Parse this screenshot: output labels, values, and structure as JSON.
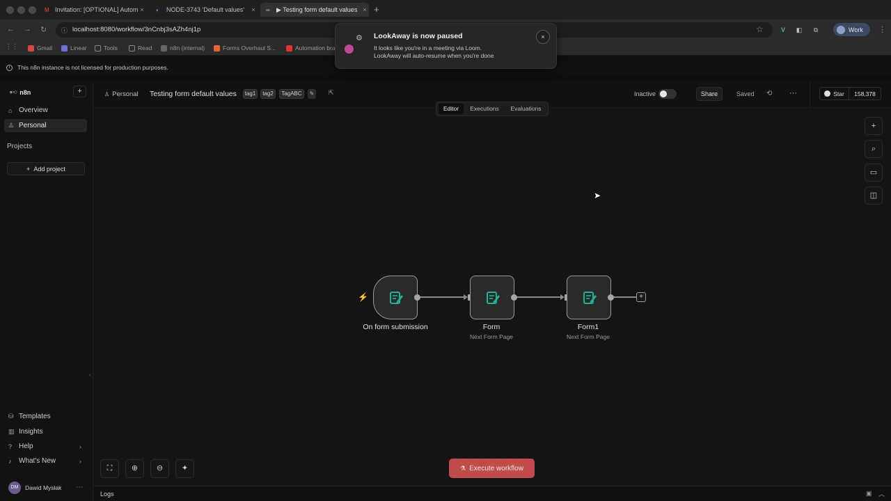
{
  "browser": {
    "tabs": [
      {
        "label": "Invitation: [OPTIONAL] Automa",
        "icon": "gmail-icon"
      },
      {
        "label": "NODE-3743 'Default values'",
        "icon": "linear-icon"
      },
      {
        "label": "▶ Testing form default values",
        "icon": "n8n-icon"
      }
    ],
    "new_tab": "+",
    "url": "localhost:8080/workflow/3nCnbj3sAZh4nj1p",
    "profile": "Work",
    "bookmarks": [
      "Gmail",
      "Linear",
      "Tools",
      "Read",
      "n8n (internal)",
      "Forms Overhaul S...",
      "Automation bra"
    ]
  },
  "toast": {
    "title": "LookAway is now paused",
    "line1": "It looks like you're in a meeting via Loom.",
    "line2": "LookAway will auto-resume when you're done",
    "close": "×"
  },
  "banner": {
    "text": "This n8n instance is not licensed for production purposes."
  },
  "sidebar": {
    "logo": "n8n",
    "plus": "+",
    "items": [
      {
        "label": "Overview",
        "icon": "home-icon"
      },
      {
        "label": "Personal",
        "icon": "user-icon"
      }
    ],
    "projects_title": "Projects",
    "add_project": "Add project",
    "bottom": [
      {
        "label": "Templates",
        "icon": "templates-icon"
      },
      {
        "label": "Insights",
        "icon": "insights-icon"
      },
      {
        "label": "Help",
        "icon": "help-icon"
      },
      {
        "label": "What's New",
        "icon": "bell-icon"
      }
    ],
    "user": {
      "name": "Dawid Myslak",
      "initials": "DM"
    }
  },
  "header": {
    "breadcrumb": "Personal",
    "workflow_name": "Testing form default values",
    "tags": [
      "tag1",
      "tag2",
      "TagABC"
    ],
    "status": "Inactive",
    "active": false,
    "share": "Share",
    "saved": "Saved",
    "github_star": "Star",
    "github_count": "158,378"
  },
  "view_tabs": {
    "items": [
      "Editor",
      "Executions",
      "Evaluations"
    ],
    "selected": "Editor"
  },
  "workflow": {
    "nodes": [
      {
        "title": "On form submission",
        "subtitle": ""
      },
      {
        "title": "Form",
        "subtitle": "Next Form Page"
      },
      {
        "title": "Form1",
        "subtitle": "Next Form Page"
      }
    ]
  },
  "canvas": {
    "execute_label": "Execute workflow"
  },
  "logs": {
    "label": "Logs"
  },
  "colors": {
    "accent": "#c14a4a",
    "node_icon": "#1fb39a",
    "trigger_bolt": "#ff6d5a"
  }
}
